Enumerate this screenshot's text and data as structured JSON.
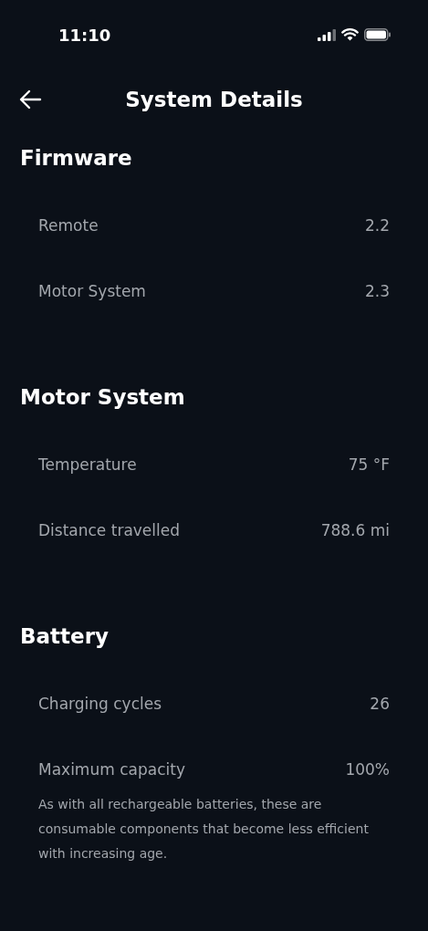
{
  "status_bar": {
    "time": "11:10"
  },
  "header": {
    "title": "System Details"
  },
  "sections": [
    {
      "title": "Firmware",
      "rows": [
        {
          "label": "Remote",
          "value": "2.2"
        },
        {
          "label": "Motor System",
          "value": "2.3"
        }
      ]
    },
    {
      "title": "Motor System",
      "rows": [
        {
          "label": "Temperature",
          "value": "75 °F"
        },
        {
          "label": "Distance travelled",
          "value": "788.6 mi"
        }
      ]
    },
    {
      "title": "Battery",
      "rows": [
        {
          "label": "Charging cycles",
          "value": "26"
        },
        {
          "label": "Maximum capacity",
          "value": "100%"
        }
      ],
      "note": "As with all rechargeable batteries, these are consumable components that become less efficient with increasing age."
    }
  ]
}
